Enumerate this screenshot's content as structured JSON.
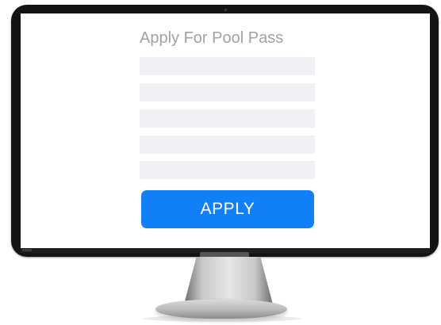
{
  "form": {
    "title": "Apply For Pool Pass",
    "fields": [
      {
        "value": "",
        "placeholder": ""
      },
      {
        "value": "",
        "placeholder": ""
      },
      {
        "value": "",
        "placeholder": ""
      },
      {
        "value": "",
        "placeholder": ""
      },
      {
        "value": "",
        "placeholder": ""
      }
    ],
    "apply_label": "APPLY"
  },
  "colors": {
    "accent": "#1180f7",
    "field_background": "#f1f1f5",
    "title_text": "#a1a1a6",
    "bezel": "#141414"
  }
}
